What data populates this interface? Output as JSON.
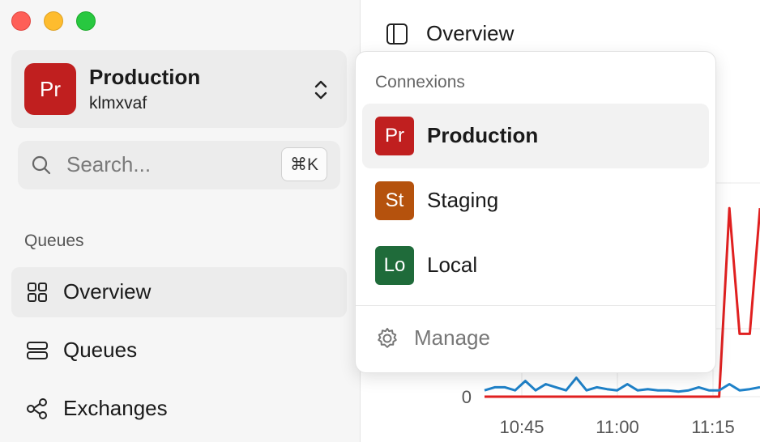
{
  "window": {
    "controls": [
      "close",
      "minimize",
      "zoom"
    ]
  },
  "connection_switcher": {
    "avatar": "Pr",
    "name": "Production",
    "id": "klmxvaf",
    "avatar_color": "#c01f1f",
    "icon": "chevron-up-down-icon"
  },
  "search": {
    "placeholder": "Search...",
    "shortcut": "⌘K",
    "icon": "search-icon"
  },
  "sidebar": {
    "section": "Queues",
    "items": [
      {
        "label": "Overview",
        "icon": "grid-icon",
        "active": true
      },
      {
        "label": "Queues",
        "icon": "queues-icon",
        "active": false
      },
      {
        "label": "Exchanges",
        "icon": "exchanges-icon",
        "active": false
      }
    ]
  },
  "main": {
    "title": "Overview",
    "icon": "sidebar-toggle-icon"
  },
  "popover": {
    "label": "Connexions",
    "items": [
      {
        "avatar": "Pr",
        "name": "Production",
        "color": "#c01f1f",
        "selected": true
      },
      {
        "avatar": "St",
        "name": "Staging",
        "color": "#b5520d",
        "selected": false
      },
      {
        "avatar": "Lo",
        "name": "Local",
        "color": "#1f6b3a",
        "selected": false
      }
    ],
    "manage": {
      "label": "Manage",
      "icon": "gear-icon"
    }
  },
  "chart_data": {
    "type": "line",
    "x_ticks": [
      "10:45",
      "11:00",
      "11:15"
    ],
    "y_ticks": [
      "0"
    ],
    "series": [
      {
        "color": "#e02020",
        "values": [
          0,
          0,
          0,
          0,
          0,
          0,
          0,
          0,
          0,
          0,
          0,
          0,
          0,
          0,
          0,
          0,
          0,
          0,
          0,
          0,
          0,
          0,
          0,
          0,
          3,
          1,
          1,
          3
        ]
      },
      {
        "color": "#1f82c9",
        "values": [
          0.1,
          0.15,
          0.15,
          0.1,
          0.25,
          0.1,
          0.2,
          0.15,
          0.1,
          0.3,
          0.1,
          0.15,
          0.12,
          0.1,
          0.2,
          0.1,
          0.12,
          0.1,
          0.1,
          0.08,
          0.1,
          0.15,
          0.1,
          0.1,
          0.2,
          0.1,
          0.12,
          0.15
        ]
      }
    ],
    "ylim": [
      0,
      3.4
    ]
  }
}
